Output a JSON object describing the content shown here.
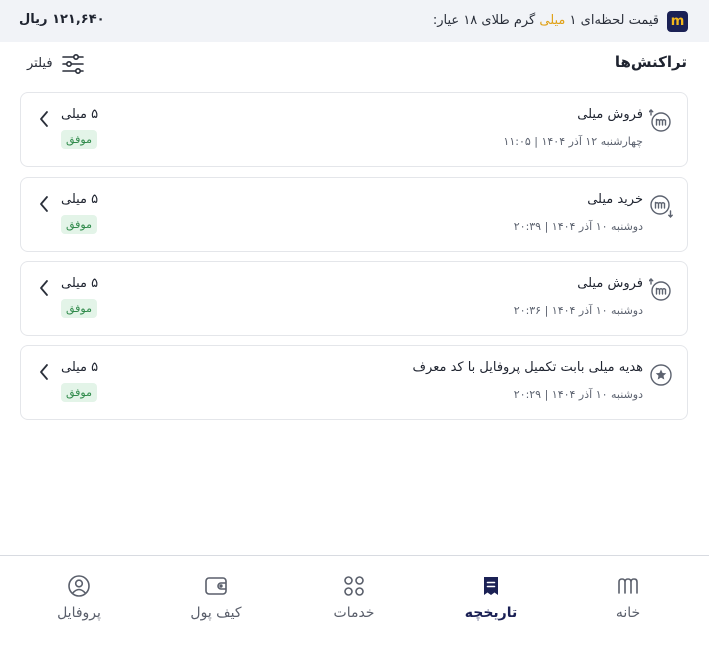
{
  "price_bar": {
    "title_before": "قیمت لحظه‌ای ۱ ",
    "title_highlight": "میلی",
    "title_after": " گرم طلای ۱۸ عیار:",
    "value": "۱۲۱,۶۴۰ ریال",
    "logo_letter": "m",
    "highlight_color": "#e0a21a"
  },
  "header": {
    "title": "تراکنش‌ها",
    "filter_label": "فیلتر"
  },
  "transactions": [
    {
      "icon": "sell-milli-icon",
      "title": "فروش میلی",
      "date": "چهارشنبه ۱۲ آذر ۱۴۰۴ | ۱۱:۰۵",
      "amount": "۵ میلی",
      "status": "موفق"
    },
    {
      "icon": "buy-milli-icon",
      "title": "خرید میلی",
      "date": "دوشنبه ۱۰ آذر ۱۴۰۴ | ۲۰:۳۹",
      "amount": "۵ میلی",
      "status": "موفق"
    },
    {
      "icon": "sell-milli-icon",
      "title": "فروش میلی",
      "date": "دوشنبه ۱۰ آذر ۱۴۰۴ | ۲۰:۳۶",
      "amount": "۵ میلی",
      "status": "موفق"
    },
    {
      "icon": "star-icon",
      "title": "هدیه میلی بابت تکمیل پروفایل با کد معرف",
      "date": "دوشنبه ۱۰ آذر ۱۴۰۴ | ۲۰:۲۹",
      "amount": "۵ میلی",
      "status": "موفق"
    }
  ],
  "nav": [
    {
      "label": "خانه",
      "icon": "home-logo-icon",
      "active": false
    },
    {
      "label": "تاریخچه",
      "icon": "history-icon",
      "active": true
    },
    {
      "label": "خدمات",
      "icon": "services-grid-icon",
      "active": false
    },
    {
      "label": "کیف پول",
      "icon": "wallet-icon",
      "active": false
    },
    {
      "label": "پروفایل",
      "icon": "profile-icon",
      "active": false
    }
  ],
  "colors": {
    "brand_navy": "#1b2155",
    "gold": "#f2b61b",
    "success_text": "#2f8a4a",
    "success_bg": "#e3f4e8"
  }
}
